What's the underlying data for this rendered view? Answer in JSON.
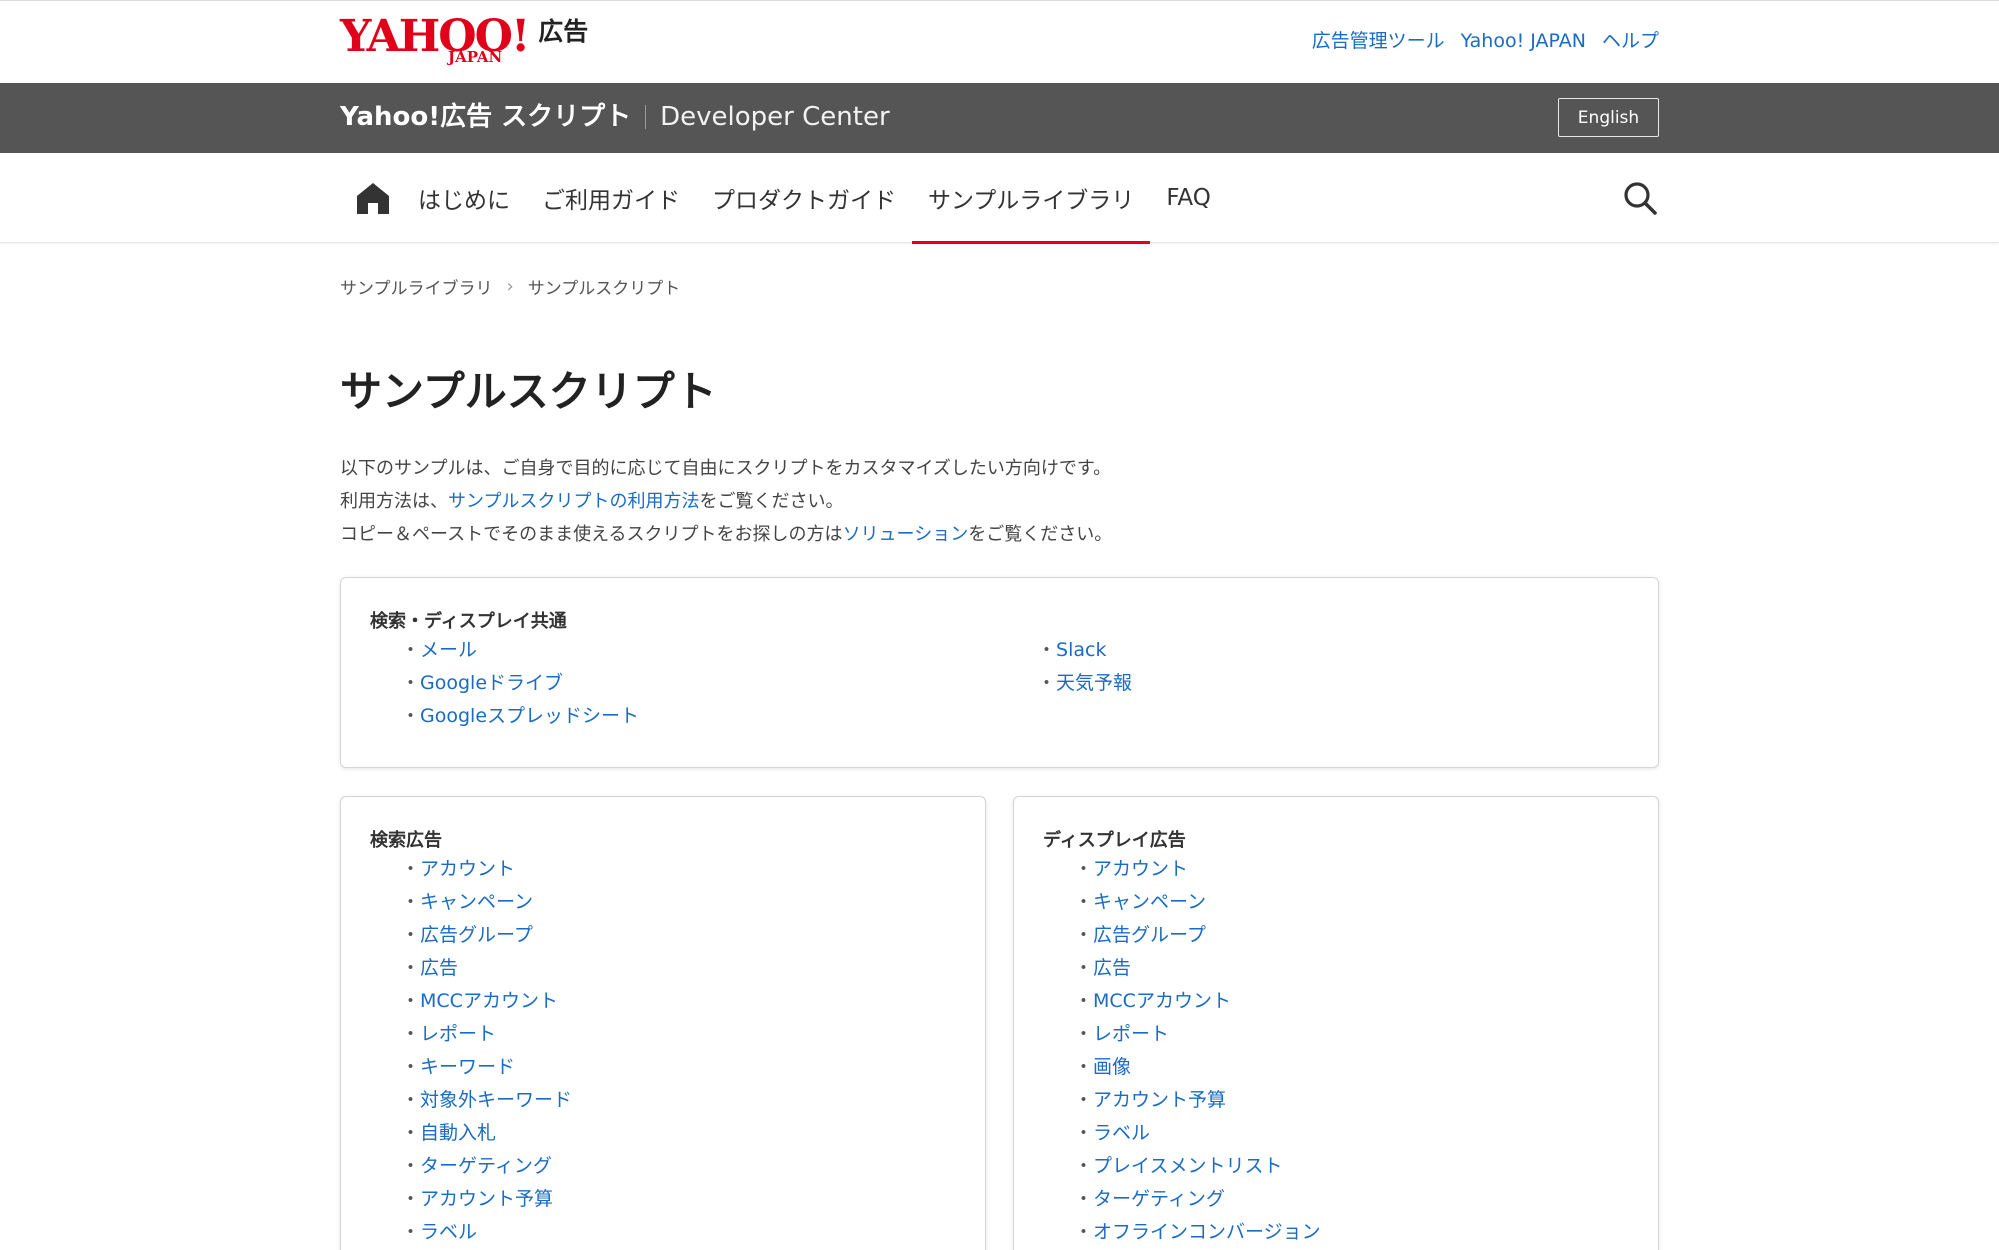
{
  "header": {
    "logo_text": "YAHOO!",
    "logo_sub": "JAPAN",
    "logo_ad": "広告",
    "links": [
      "広告管理ツール",
      "Yahoo! JAPAN",
      "ヘルプ"
    ]
  },
  "banner": {
    "title": "Yahoo!広告 スクリプト",
    "subtitle": "Developer Center",
    "lang_button": "English"
  },
  "nav": {
    "items": [
      "はじめに",
      "ご利用ガイド",
      "プロダクトガイド",
      "サンプルライブラリ",
      "FAQ"
    ],
    "active": "サンプルライブラリ"
  },
  "breadcrumb": [
    "サンプルライブラリ",
    "サンプルスクリプト"
  ],
  "page": {
    "title": "サンプルスクリプト",
    "intro_line1": "以下のサンプルは、ご自身で目的に応じて自由にスクリプトをカスタマイズしたい方向けです。",
    "intro_line2_pre": "利用方法は、",
    "intro_line2_link": "サンプルスクリプトの利用方法",
    "intro_line2_post": "をご覧ください。",
    "intro_line3_pre": "コピー＆ペーストでそのまま使えるスクリプトをお探しの方は",
    "intro_line3_link": "ソリューション",
    "intro_line3_post": "をご覧ください。"
  },
  "sections": {
    "common": {
      "title": "検索・ディスプレイ共通",
      "left": [
        "メール",
        "Googleドライブ",
        "Googleスプレッドシート"
      ],
      "right": [
        "Slack",
        "天気予報"
      ]
    },
    "search": {
      "title": "検索広告",
      "items": [
        "アカウント",
        "キャンペーン",
        "広告グループ",
        "広告",
        "MCCアカウント",
        "レポート",
        "キーワード",
        "対象外キーワード",
        "自動入札",
        "ターゲティング",
        "アカウント予算",
        "ラベル"
      ]
    },
    "display": {
      "title": "ディスプレイ広告",
      "items": [
        "アカウント",
        "キャンペーン",
        "広告グループ",
        "広告",
        "MCCアカウント",
        "レポート",
        "画像",
        "アカウント予算",
        "ラベル",
        "プレイスメントリスト",
        "ターゲティング",
        "オフラインコンバージョン"
      ]
    }
  },
  "colors": {
    "brand_red": "#e0001a",
    "link_blue": "#1a6bc4",
    "banner_gray": "#555555"
  }
}
